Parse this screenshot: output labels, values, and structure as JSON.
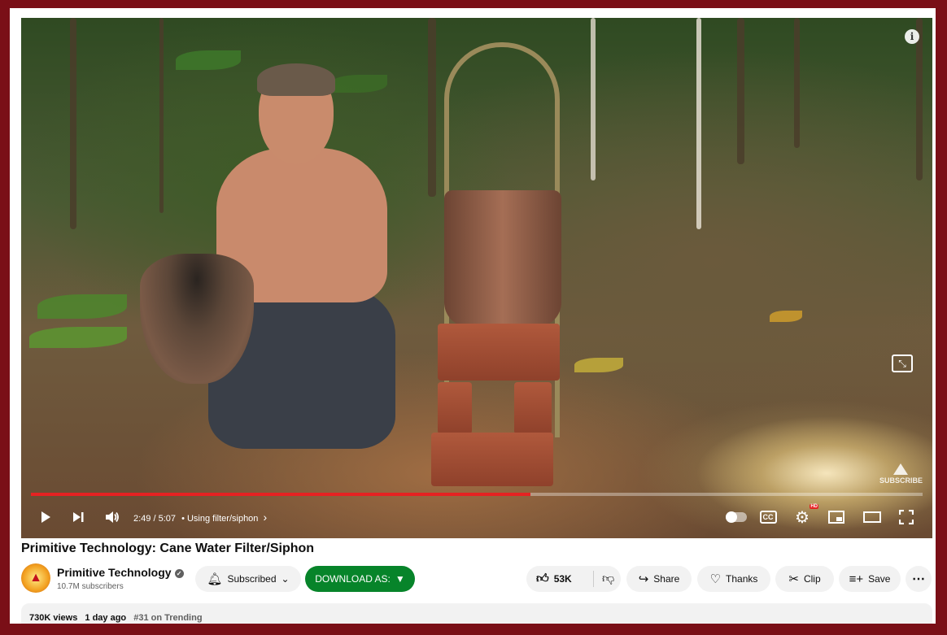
{
  "video": {
    "info_icon": "info-icon",
    "watermark_label": "SUBSCRIBE",
    "progress": {
      "played_fraction": 0.56
    },
    "time": {
      "current": "2:49",
      "separator": " / ",
      "duration": "5:07"
    },
    "chapter": "• Using filter/siphon",
    "chapter_chevron": "›",
    "cc_label": "CC",
    "hd_badge": "HD"
  },
  "title": "Primitive Technology: Cane Water Filter/Siphon",
  "channel": {
    "name": "Primitive Technology",
    "subscribers": "10.7M subscribers"
  },
  "actions": {
    "subscribed": "Subscribed",
    "download": "DOWNLOAD AS:",
    "download_arrow": "▼",
    "likes": "53K",
    "share": "Share",
    "thanks": "Thanks",
    "clip": "Clip",
    "save": "Save",
    "more": "⋯"
  },
  "description": {
    "views": "730K views",
    "date": "1 day ago",
    "trending": "#31 on Trending"
  },
  "colors": {
    "border": "#7a0f17",
    "progress": "#e52222",
    "download_bg": "#07842a"
  }
}
